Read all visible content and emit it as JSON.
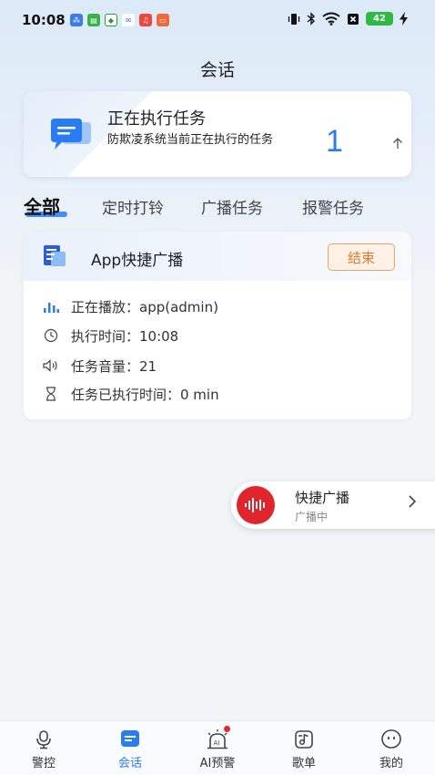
{
  "status_bar": {
    "time": "10:08",
    "battery": "42"
  },
  "header": {
    "title": "会话"
  },
  "executing": {
    "title": "正在执行任务",
    "description": "防欺凌系统当前正在执行的任务",
    "count": "1",
    "toggle_icon": "up-arrow-icon"
  },
  "tabs": [
    {
      "label": "全部",
      "active": true
    },
    {
      "label": "定时打铃",
      "active": false
    },
    {
      "label": "广播任务",
      "active": false
    },
    {
      "label": "报警任务",
      "active": false
    }
  ],
  "task": {
    "title": "App快捷广播",
    "end_label": "结束",
    "rows": [
      {
        "icon": "bar-chart-icon",
        "text": "正在播放：app(admin)"
      },
      {
        "icon": "clock-icon",
        "text": "执行时间：10:08"
      },
      {
        "icon": "speaker-icon",
        "text": "任务音量：21"
      },
      {
        "icon": "hourglass-icon",
        "text": "任务已执行时间：0 min"
      }
    ]
  },
  "quick_broadcast": {
    "title": "快捷广播",
    "subtitle": "广播中"
  },
  "bottom_nav": [
    {
      "label": "警控",
      "icon": "microphone-icon",
      "active": false
    },
    {
      "label": "会话",
      "icon": "chat-icon",
      "active": true
    },
    {
      "label": "AI预警",
      "icon": "ai-alarm-icon",
      "active": false,
      "badge": true
    },
    {
      "label": "歌单",
      "icon": "music-list-icon",
      "active": false
    },
    {
      "label": "我的",
      "icon": "smiley-icon",
      "active": false
    }
  ],
  "colors": {
    "accent": "#2a7cf0",
    "end_button": "#e07b2e",
    "broadcast_red": "#e0262a"
  }
}
